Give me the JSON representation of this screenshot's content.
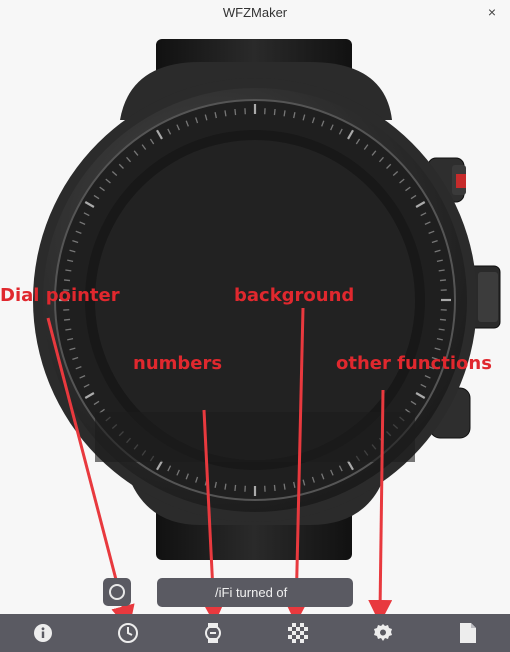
{
  "window": {
    "title": "WFZMaker",
    "close_glyph": "×"
  },
  "annotations": {
    "dial_pointer": "Dial  pointer",
    "background": "background",
    "numbers": "numbers",
    "other_functions": "other  functions"
  },
  "status": {
    "wifi_text": "/iFi turned of"
  },
  "toolbar": {
    "items": [
      {
        "icon": "info-icon"
      },
      {
        "icon": "clock-icon"
      },
      {
        "icon": "watch-icon"
      },
      {
        "icon": "checkerboard-icon"
      },
      {
        "icon": "settings-icon"
      },
      {
        "icon": "document-icon"
      }
    ]
  },
  "colors": {
    "annotation": "#e0282e",
    "bar": "#5a5a62",
    "watch_face": "#222222"
  }
}
